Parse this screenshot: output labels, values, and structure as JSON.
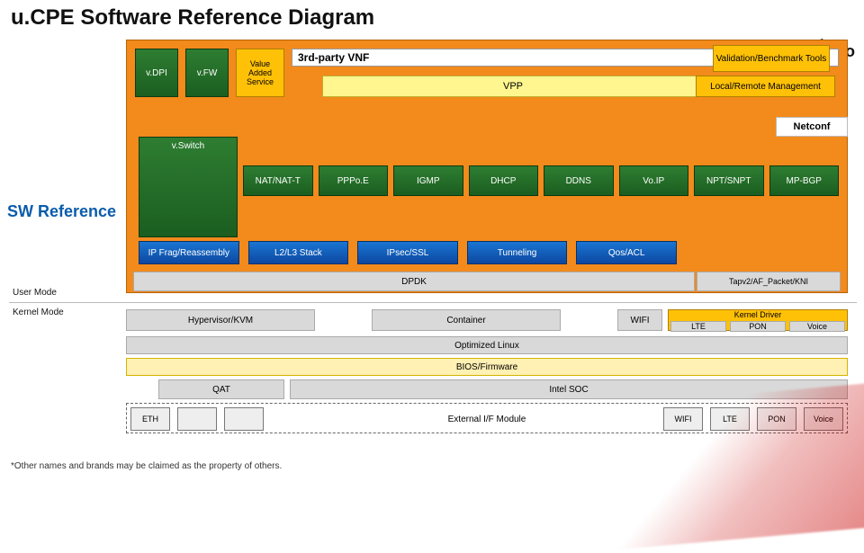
{
  "title": "u.CPE Software Reference Diagram",
  "logo_suffix": ".io",
  "sw_reference": "SW Reference",
  "mode_user": "User Mode",
  "mode_kernel": "Kernel Mode",
  "footnote": "*Other names and brands may be claimed as the property of others.",
  "top": {
    "vdpi": "v.DPI",
    "vfw": "v.FW",
    "vas": "Value Added Service",
    "third_party": "3rd-party VNF",
    "validation": "Validation/Benchmark Tools",
    "vpp": "VPP",
    "mgmt": "Local/Remote Management",
    "netconf": "Netconf"
  },
  "vswitch": "v.Switch",
  "green": [
    "NAT/NAT-T",
    "PPPo.E",
    "IGMP",
    "DHCP",
    "DDNS",
    "Vo.IP",
    "NPT/SNPT",
    "MP-BGP"
  ],
  "blue": [
    "IP Frag/Reassembly",
    "L2/L3 Stack",
    "IPsec/SSL",
    "Tunneling",
    "Qos/ACL"
  ],
  "dpdk": "DPDK",
  "tap": "Tapv2/AF_Packet/KNI",
  "hyper": {
    "hypervisor": "Hypervisor/KVM",
    "container": "Container",
    "wifi": "WIFI",
    "kernel_driver_title": "Kernel Driver",
    "kds": [
      "LTE",
      "PON",
      "Voice"
    ]
  },
  "rows": {
    "optimized": "Optimized Linux",
    "bios": "BIOS/Firmware",
    "qat": "QAT",
    "soc": "Intel SOC",
    "ext_label": "External I/F Module",
    "ext_if": [
      "ETH",
      "",
      "",
      "WIFI",
      "LTE",
      "PON",
      "Voice"
    ]
  }
}
